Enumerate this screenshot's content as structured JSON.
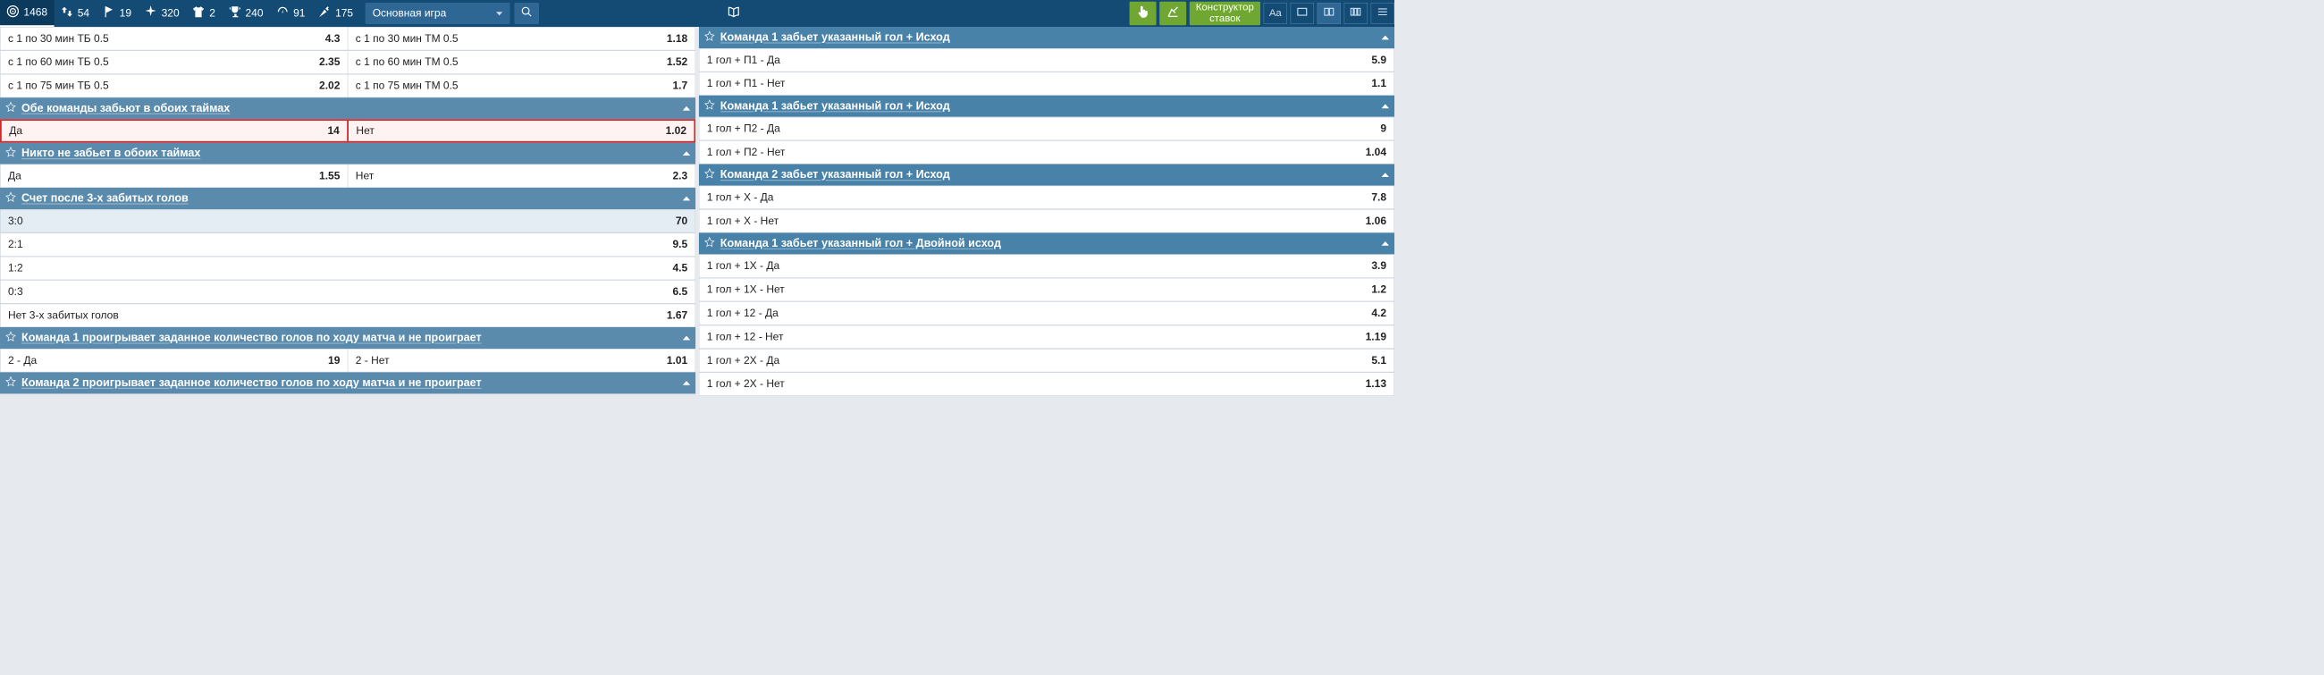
{
  "stats": {
    "target": "1468",
    "swap": "54",
    "corner": "19",
    "starburst": "320",
    "shirt": "2",
    "trophy": "240",
    "gauge": "91",
    "dart": "175"
  },
  "dropdown": {
    "label": "Основная игра"
  },
  "greenBtn3": {
    "line1": "Конструктор",
    "line2": "ставок"
  },
  "fontCtrlLabel": "Aa",
  "left": {
    "overUnderRows": [
      {
        "l": "с 1 по 30 мин ТБ 0.5",
        "lo": "4.3",
        "r": "с 1 по 30 мин ТМ 0.5",
        "ro": "1.18"
      },
      {
        "l": "с 1 по 60 мин ТБ 0.5",
        "lo": "2.35",
        "r": "с 1 по 60 мин ТМ 0.5",
        "ro": "1.52"
      },
      {
        "l": "с 1 по 75 мин ТБ 0.5",
        "lo": "2.02",
        "r": "с 1 по 75 мин ТМ 0.5",
        "ro": "1.7"
      }
    ],
    "sections": [
      {
        "title": "Обе команды забьют в обоих таймах",
        "pair": {
          "l": "Да",
          "lo": "14",
          "r": "Нет",
          "ro": "1.02",
          "highlight": true
        }
      },
      {
        "title": "Никто не забьет в обоих таймах",
        "pair": {
          "l": "Да",
          "lo": "1.55",
          "r": "Нет",
          "ro": "2.3"
        }
      },
      {
        "title": "Счет после 3-х забитых голов",
        "rows": [
          {
            "t": "3:0",
            "o": "70",
            "alt": true
          },
          {
            "t": "2:1",
            "o": "9.5"
          },
          {
            "t": "1:2",
            "o": "4.5"
          },
          {
            "t": "0:3",
            "o": "6.5"
          },
          {
            "t": "Нет 3-х забитых голов",
            "o": "1.67"
          }
        ]
      },
      {
        "title": "Команда 1 проигрывает заданное количество голов по ходу матча и не проиграет",
        "pair": {
          "l": "2 - Да",
          "lo": "19",
          "r": "2 - Нет",
          "ro": "1.01"
        }
      },
      {
        "title": "Команда 2 проигрывает заданное количество голов по ходу матча и не проиграет"
      }
    ]
  },
  "right": {
    "sections": [
      {
        "title": "Команда 1 забьет указанный гол + Исход",
        "rows": [
          {
            "t": "1 гол + П1 - Да",
            "o": "5.9"
          },
          {
            "t": "1 гол + П1 - Нет",
            "o": "1.1"
          }
        ]
      },
      {
        "title": "Команда 1 забьет указанный гол + Исход",
        "rows": [
          {
            "t": "1 гол + П2 - Да",
            "o": "9"
          },
          {
            "t": "1 гол + П2 - Нет",
            "o": "1.04"
          }
        ]
      },
      {
        "title": "Команда 2 забьет указанный гол + Исход",
        "rows": [
          {
            "t": "1 гол + Х - Да",
            "o": "7.8"
          },
          {
            "t": "1 гол + Х - Нет",
            "o": "1.06"
          }
        ]
      },
      {
        "title": "Команда 1 забьет указанный гол + Двойной исход",
        "rows": [
          {
            "t": "1 гол + 1Х - Да",
            "o": "3.9"
          },
          {
            "t": "1 гол + 1Х - Нет",
            "o": "1.2"
          },
          {
            "t": "1 гол + 12 - Да",
            "o": "4.2"
          },
          {
            "t": "1 гол + 12 - Нет",
            "o": "1.19"
          },
          {
            "t": "1 гол + 2Х - Да",
            "o": "5.1"
          },
          {
            "t": "1 гол + 2Х - Нет",
            "o": "1.13"
          }
        ]
      }
    ]
  }
}
